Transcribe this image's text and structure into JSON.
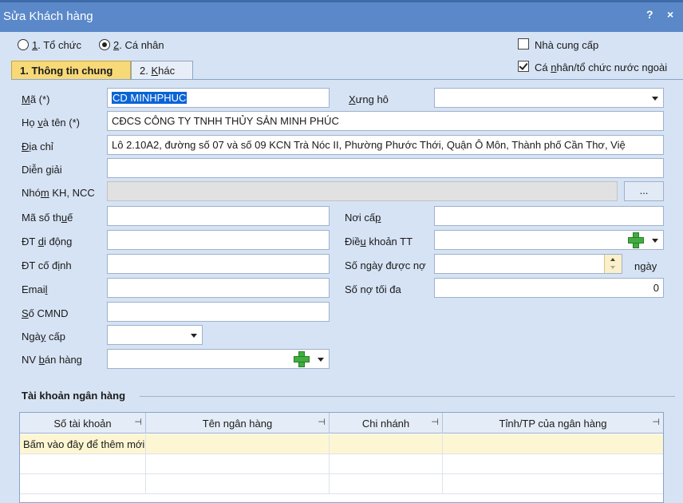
{
  "window": {
    "title": "Sửa Khách hàng",
    "help_label": "?",
    "close_label": "×"
  },
  "customer_type": {
    "option1_prefix": "1",
    "option1_text": ". Tổ chức",
    "option2_prefix": "2",
    "option2_text": ". Cá nhân",
    "selected": "2"
  },
  "flags": {
    "supplier_label": "Nhà cung cấp",
    "supplier_checked": false,
    "foreign_prefix": "Cá ",
    "foreign_ul": "n",
    "foreign_rest": "hân/tổ chức nước ngoài",
    "foreign_checked": true
  },
  "tabs": [
    {
      "label": "1. Thông tin chung",
      "active": true
    },
    {
      "label": "2. Khác",
      "label_prefix": "2. ",
      "label_ul": "K",
      "label_rest": "hác",
      "active": false
    }
  ],
  "form": {
    "code": {
      "label_ul": "M",
      "label_rest": "ã (*)",
      "value": "CD MINHPHUC"
    },
    "salutation": {
      "label_ul": "X",
      "label_rest": "ưng hô",
      "value": ""
    },
    "full_name": {
      "label_a": "Họ ",
      "label_ul": "v",
      "label_b": "à tên (*)",
      "value": "CĐCS CÔNG TY TNHH THỦY SẢN MINH PHÚC"
    },
    "address": {
      "label_ul": "Đ",
      "label_rest": "ịa chỉ",
      "value": "Lô 2.10A2, đường số 07 và số 09 KCN Trà Nóc II, Phường Phước Thới, Quận Ô Môn, Thành phố Cần Thơ, Việ"
    },
    "description": {
      "label_a": "Diễn ",
      "label_ul": "g",
      "label_b": "iải",
      "value": ""
    },
    "group": {
      "label_a": "Nhó",
      "label_ul": "m",
      "label_b": " KH, NCC",
      "value": "",
      "button": "..."
    },
    "tax_code": {
      "label_a": "Mã số th",
      "label_ul": "u",
      "label_b": "ế",
      "value": ""
    },
    "issued_place": {
      "label_a": "Nơi cấ",
      "label_ul": "p",
      "value": ""
    },
    "mobile": {
      "label_a": "ĐT ",
      "label_ul": "d",
      "label_b": "i động",
      "value": ""
    },
    "payment_terms": {
      "label_a": "Điề",
      "label_ul": "u",
      "label_b": " khoản TT",
      "value": ""
    },
    "landline": {
      "label_a": "ĐT cố đ",
      "label_ul": "ị",
      "label_b": "nh",
      "value": ""
    },
    "debt_days": {
      "label": "Số ngày được nợ",
      "value": "",
      "unit": "ngày"
    },
    "email": {
      "label_a": "Emai",
      "label_ul": "l",
      "value": ""
    },
    "max_debt": {
      "label": "Số nợ tối đa",
      "value": "0"
    },
    "id_number": {
      "label_ul": "S",
      "label_rest": "ố CMND",
      "value": ""
    },
    "issued_date": {
      "label_a": "Ngà",
      "label_ul": "y",
      "label_b": " cấp",
      "value": ""
    },
    "salesperson": {
      "label_a": "NV ",
      "label_ul": "b",
      "label_b": "án hàng",
      "value": ""
    }
  },
  "bank": {
    "title": "Tài khoản ngân hàng",
    "columns": [
      "Số tài khoản",
      "Tên ngân hàng",
      "Chi nhánh",
      "Tỉnh/TP của ngân hàng"
    ],
    "pin_glyph": "⊣",
    "new_row_text": "Bấm vào đây để thêm mới"
  },
  "colors": {
    "titlebar": "#5a88c9",
    "background": "#d6e3f4",
    "active_tab": "#f7d977",
    "selection": "#0a64d6",
    "new_row": "#fdf6d3"
  }
}
